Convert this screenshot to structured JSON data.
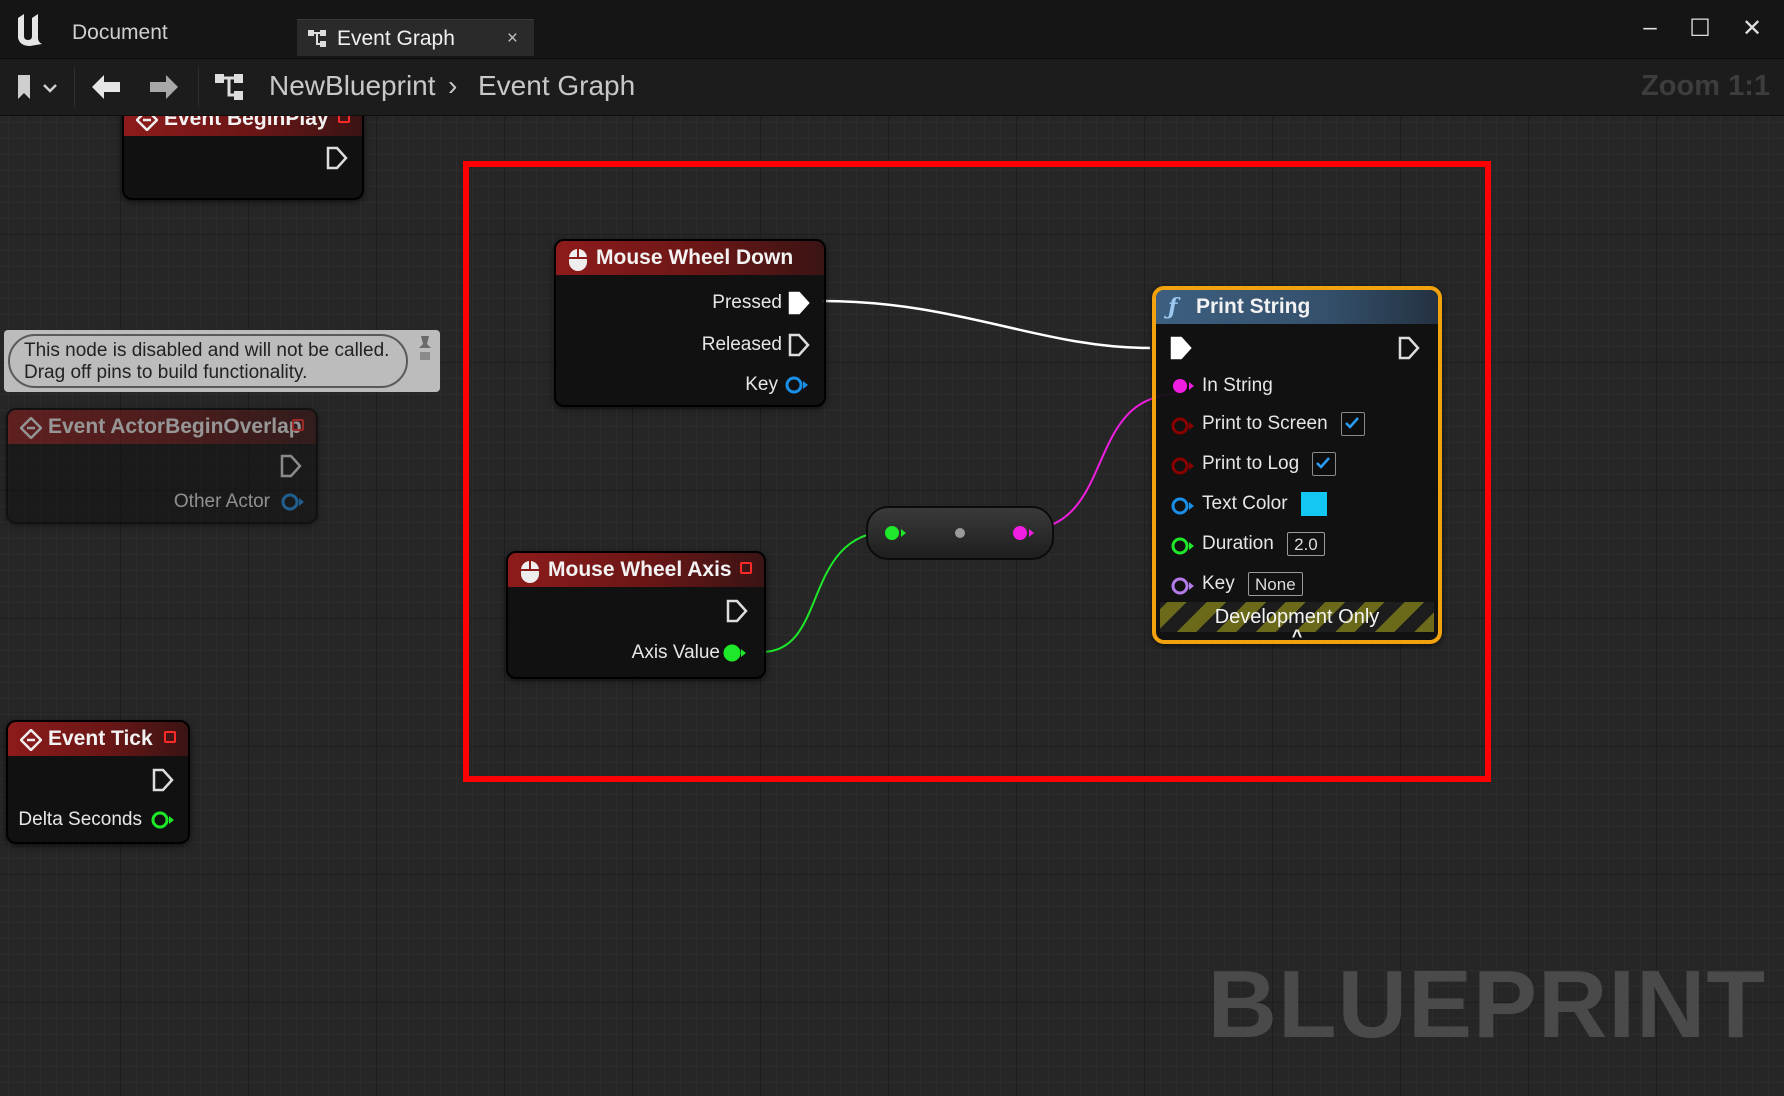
{
  "window": {
    "tabs": [
      {
        "label": "Document",
        "active": false
      },
      {
        "label": "Event Graph",
        "active": true,
        "close": "×"
      }
    ],
    "controls": {
      "minimize": "–",
      "maximize": "☐",
      "close": "✕"
    }
  },
  "toolbar": {
    "breadcrumb": [
      "NewBlueprint",
      "Event Graph"
    ],
    "breadcrumb_sep": "›",
    "zoom": "Zoom 1:1"
  },
  "canvas": {
    "watermark": "BLUEPRINT"
  },
  "comment": {
    "text_line1": "This node is disabled and will not be called.",
    "text_line2": "Drag off pins to build functionality."
  },
  "nodes": {
    "begin_play": {
      "title": "Event BeginPlay"
    },
    "actor_overlap": {
      "title": "Event ActorBeginOverlap",
      "pin_other_actor": "Other Actor"
    },
    "event_tick": {
      "title": "Event Tick",
      "pin_delta": "Delta Seconds"
    },
    "wheel_down": {
      "title": "Mouse Wheel Down",
      "pin_pressed": "Pressed",
      "pin_released": "Released",
      "pin_key": "Key"
    },
    "wheel_axis": {
      "title": "Mouse Wheel Axis",
      "pin_axis": "Axis Value"
    },
    "print_string": {
      "title": "Print String",
      "in_string": "In String",
      "print_to_screen": "Print to Screen",
      "print_to_screen_checked": true,
      "print_to_log": "Print to Log",
      "print_to_log_checked": true,
      "text_color": "Text Color",
      "text_color_value": "#12c8f2",
      "duration": "Duration",
      "duration_value": "2.0",
      "key": "Key",
      "key_value": "None",
      "dev_band": "Development Only",
      "expand": "^"
    }
  },
  "colors": {
    "exec_wire": "#ffffff",
    "float_pin": "#1ee82a",
    "string_pin": "#f01ee0",
    "object_pin": "#1a8fe8",
    "bool_pin": "#8a0000",
    "name_pin": "#b47ce8",
    "selection": "#ff0000",
    "highlight": "#f2a20e"
  }
}
